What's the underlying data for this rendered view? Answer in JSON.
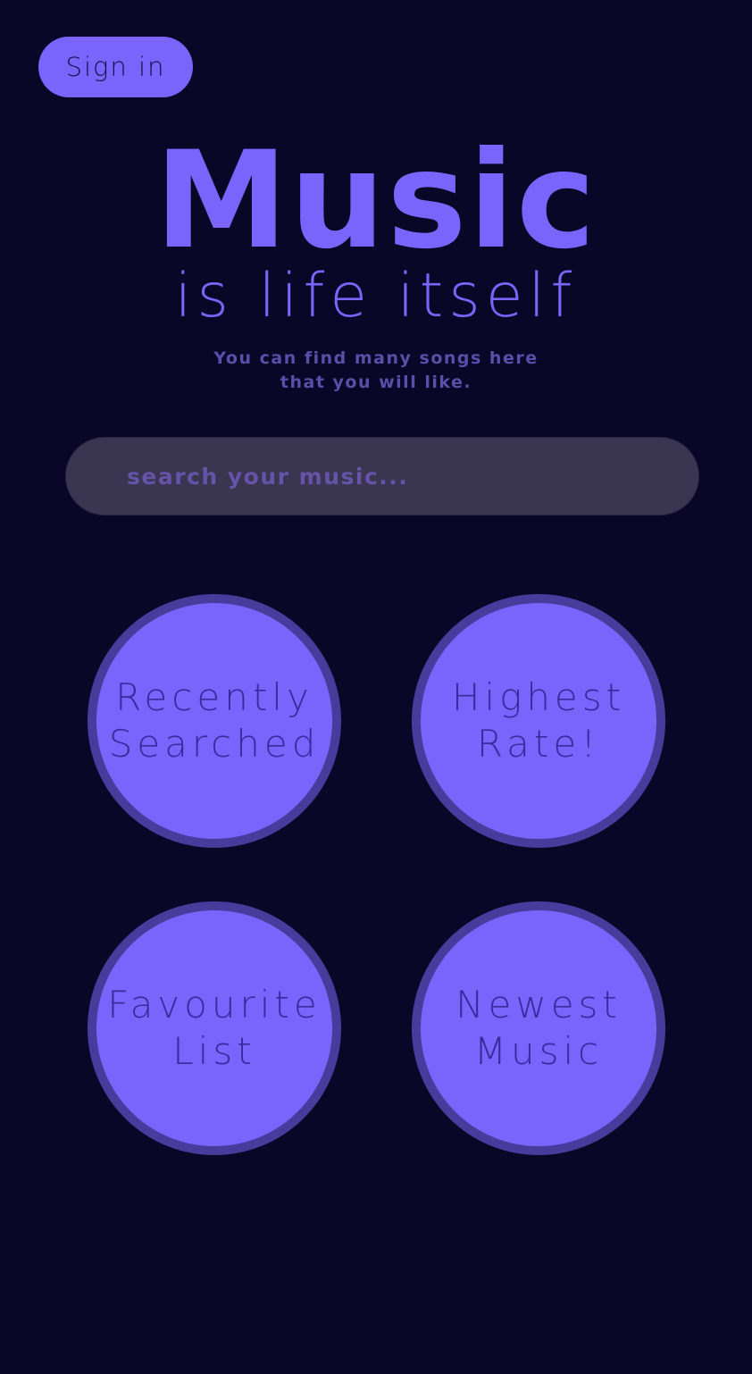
{
  "header": {
    "sign_in_label": "Sign in"
  },
  "hero": {
    "title": "Music",
    "subtitle": "is life itself",
    "tagline_line1": "You can find many songs here",
    "tagline_line2": "that you will like."
  },
  "search": {
    "placeholder": "search your music...",
    "value": ""
  },
  "categories": [
    {
      "label": "Recently\nSearched"
    },
    {
      "label": "Highest\nRate!"
    },
    {
      "label": "Favourite\nList"
    },
    {
      "label": "Newest\nMusic"
    }
  ],
  "colors": {
    "background": "#0a0628",
    "accent": "#7b64fb",
    "circle_border": "#473c9b",
    "circle_text": "#3a2a9e",
    "search_bg": "#3a3652",
    "muted_text": "#5b4ea8"
  }
}
